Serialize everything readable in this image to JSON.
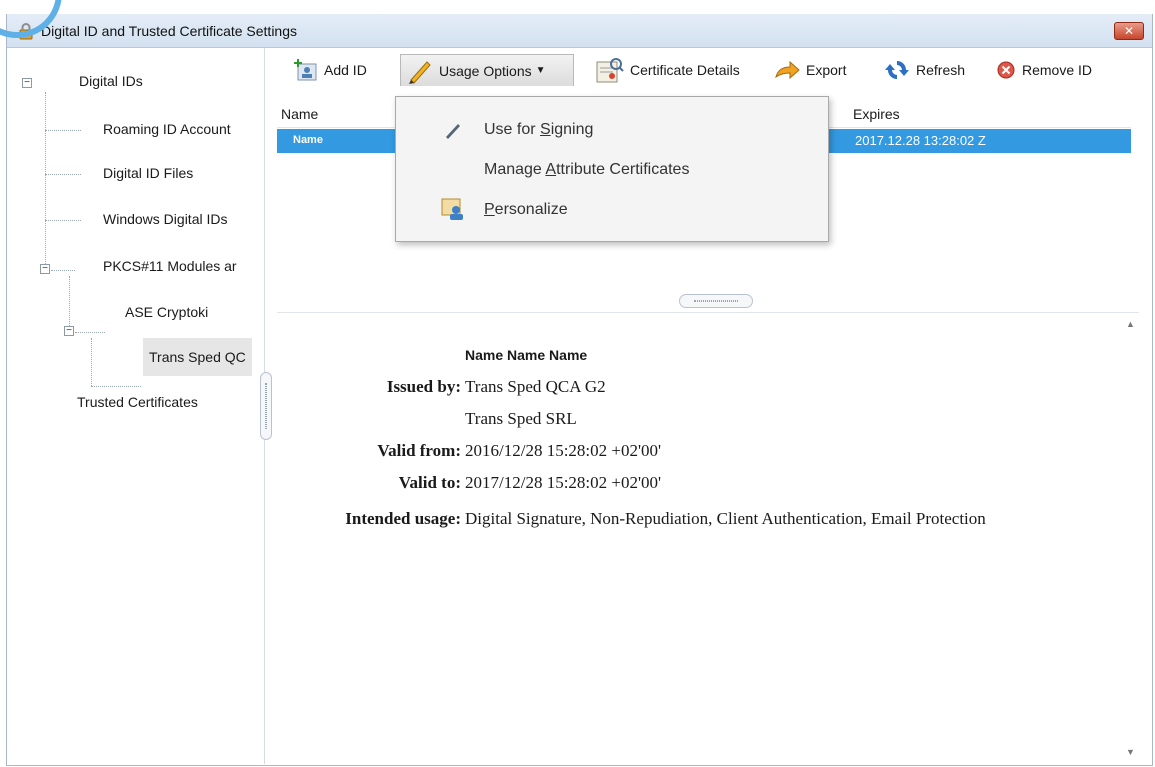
{
  "window": {
    "title": "Digital ID and Trusted Certificate Settings",
    "close_label": "✕"
  },
  "tree": {
    "digital_ids": "Digital IDs",
    "roaming": "Roaming ID Account",
    "files": "Digital ID Files",
    "windows": "Windows Digital IDs",
    "pkcs": "PKCS#11 Modules ar",
    "ase": "ASE Cryptoki",
    "trans": "Trans Sped QC",
    "trusted": "Trusted Certificates"
  },
  "toolbar": {
    "add_id": "Add ID",
    "usage_options": "Usage Options",
    "certificate_details": "Certificate Details",
    "export": "Export",
    "refresh": "Refresh",
    "remove_id": "Remove ID"
  },
  "menu": {
    "use_for_signing_prefix": "Use for ",
    "use_for_signing_accel": "S",
    "use_for_signing_suffix": "igning",
    "manage_prefix": "Manage ",
    "manage_accel": "A",
    "manage_suffix": "ttribute Certificates",
    "personalize_accel": "P",
    "personalize_suffix": "ersonalize"
  },
  "list": {
    "columns": {
      "name": "Name",
      "expires": "Expires"
    },
    "rows": [
      {
        "name": "Name",
        "expires": "2017.12.28 13:28:02 Z"
      }
    ]
  },
  "details": {
    "title": "Name Name Name",
    "issued_by_label": "Issued by:",
    "issued_by": "Trans Sped QCA G2",
    "issuer_org": "Trans Sped SRL",
    "valid_from_label": "Valid from:",
    "valid_from": "2016/12/28 15:28:02 +02'00'",
    "valid_to_label": "Valid to:",
    "valid_to": "2017/12/28 15:28:02 +02'00'",
    "usage_label": "Intended usage:",
    "usage": "Digital Signature, Non-Repudiation, Client Authentication, Email Protection"
  },
  "colors": {
    "selection": "#3399e0",
    "titlebar": "#d3e1f0",
    "close": "#c7462c",
    "menu_bg": "#f4f4f4"
  }
}
